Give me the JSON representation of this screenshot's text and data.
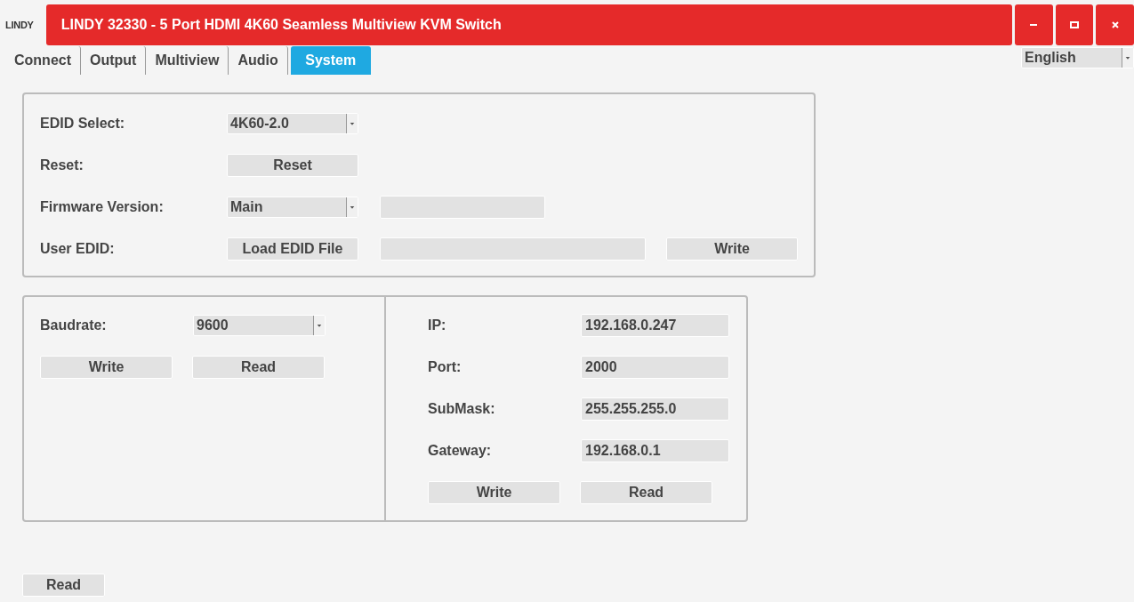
{
  "logo": "LINDY",
  "window": {
    "title": "LINDY 32330 - 5 Port HDMI 4K60 Seamless Multiview KVM Switch"
  },
  "tabs": [
    {
      "label": "Connect",
      "selected": false
    },
    {
      "label": "Output",
      "selected": false
    },
    {
      "label": "Multiview",
      "selected": false
    },
    {
      "label": "Audio",
      "selected": false
    },
    {
      "label": "System",
      "selected": true
    }
  ],
  "language": {
    "value": "English"
  },
  "edid_panel": {
    "edid_select": {
      "label": "EDID Select:",
      "value": "4K60-2.0"
    },
    "reset": {
      "label": "Reset:",
      "button": "Reset"
    },
    "firmware": {
      "label": "Firmware Version:",
      "value": "Main"
    },
    "user_edid": {
      "label": "User EDID:",
      "button": "Load EDID File",
      "write_button": "Write"
    }
  },
  "serial_panel": {
    "baudrate": {
      "label": "Baudrate:",
      "value": "9600"
    },
    "buttons": [
      "Write",
      "Read"
    ]
  },
  "network_panel": {
    "fields": [
      {
        "label": "IP:",
        "value": "192.168.0.247"
      },
      {
        "label": "Port:",
        "value": "2000"
      },
      {
        "label": "SubMask:",
        "value": "255.255.255.0"
      },
      {
        "label": "Gateway:",
        "value": "192.168.0.1"
      }
    ],
    "buttons": [
      "Write",
      "Read"
    ]
  },
  "bottom_button": "Read"
}
